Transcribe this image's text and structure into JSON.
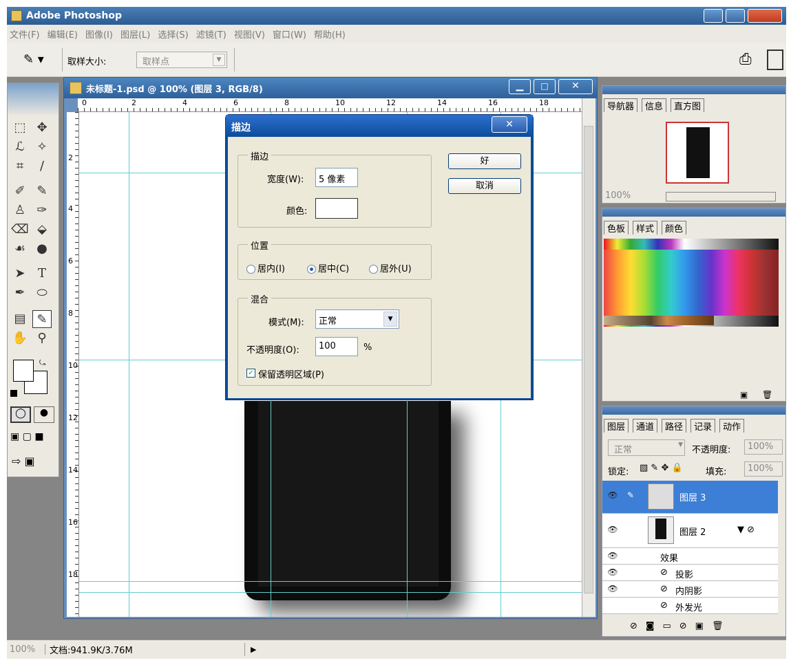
{
  "app": {
    "title": "Adobe Photoshop"
  },
  "menu": [
    "文件(F)",
    "编辑(E)",
    "图像(I)",
    "图层(L)",
    "选择(S)",
    "滤镜(T)",
    "视图(V)",
    "窗口(W)",
    "帮助(H)"
  ],
  "options": {
    "sample_label": "取样大小:",
    "sample_value": "取样点"
  },
  "document": {
    "title": "未标题-1.psd @ 100% (图层 3, RGB/8)",
    "ruler_h": [
      "0",
      "2",
      "4",
      "6",
      "8",
      "10",
      "12",
      "14",
      "16",
      "18"
    ],
    "ruler_v": [
      "2",
      "4",
      "6",
      "8",
      "10",
      "12",
      "14",
      "16",
      "18"
    ]
  },
  "dialog": {
    "title": "描边",
    "ok": "好",
    "cancel": "取消",
    "stroke_group": "描边",
    "width_label": "宽度(W):",
    "width_value": "5 像素",
    "color_label": "颜色:",
    "position_group": "位置",
    "inside": "居内(I)",
    "center": "居中(C)",
    "outside": "居外(U)",
    "selected_position": "center",
    "blend_group": "混合",
    "mode_label": "模式(M):",
    "mode_value": "正常",
    "opacity_label": "不透明度(O):",
    "opacity_value": "100",
    "percent": "%",
    "preserve_label": "保留透明区域(P)",
    "preserve_checked": true
  },
  "navigator": {
    "tabs": [
      "导航器",
      "信息",
      "直方图"
    ],
    "zoom": "100%"
  },
  "swatches": {
    "tabs": [
      "色板",
      "样式",
      "颜色"
    ]
  },
  "layers": {
    "tabs": [
      "图层",
      "通道",
      "路径",
      "记录",
      "动作"
    ],
    "blend_mode": "正常",
    "opacity_label": "不透明度:",
    "opacity_value": "100%",
    "lock_label": "锁定:",
    "fill_label": "填充:",
    "fill_value": "100%",
    "items": [
      {
        "name": "图层 3",
        "selected": true
      },
      {
        "name": "图层 2",
        "selected": false
      }
    ],
    "effects_label": "效果",
    "effects": [
      "投影",
      "内阴影",
      "外发光"
    ]
  },
  "status": {
    "zoom": "100%",
    "doc": "文档:941.9K/3.76M"
  }
}
